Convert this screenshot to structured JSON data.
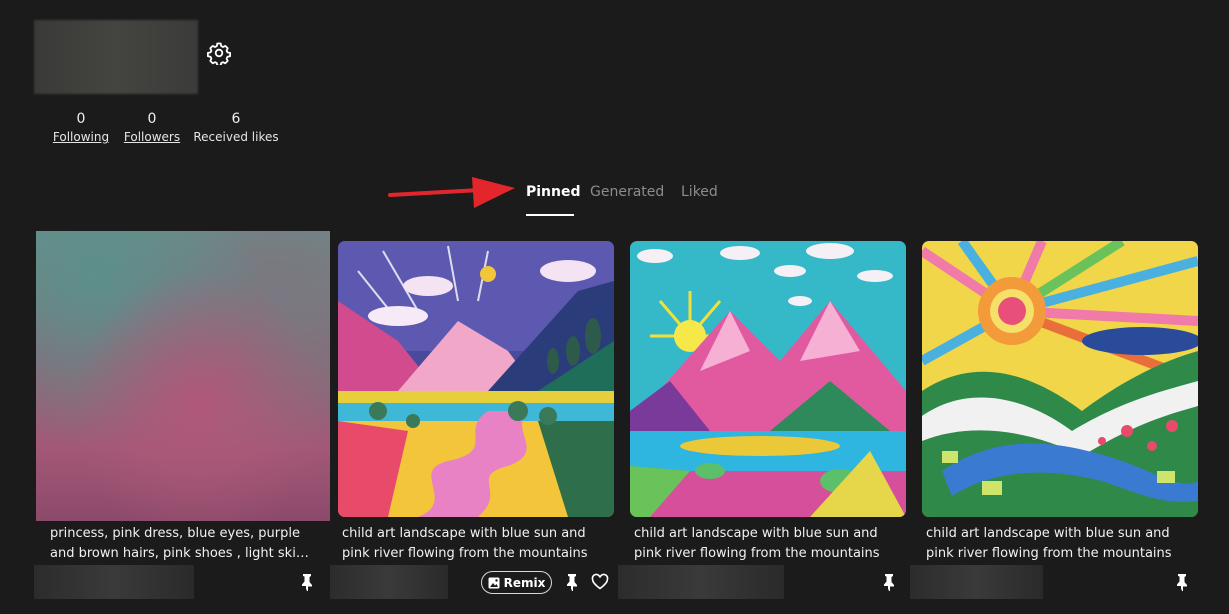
{
  "profile": {
    "stats": [
      {
        "count": "0",
        "label": "Following"
      },
      {
        "count": "0",
        "label": "Followers"
      },
      {
        "count": "6",
        "label": "Received likes"
      }
    ]
  },
  "tabs": [
    {
      "label": "Pinned",
      "active": true
    },
    {
      "label": "Generated",
      "active": false
    },
    {
      "label": "Liked",
      "active": false
    }
  ],
  "cards": [
    {
      "caption_line1": "princess, pink dress, blue eyes, purple",
      "caption_line2": "and brown hairs, pink shoes , light skin..."
    },
    {
      "caption_line1": "child art landscape with blue sun and",
      "caption_line2": "pink river flowing from the mountains"
    },
    {
      "caption_line1": "child art landscape with blue sun and",
      "caption_line2": "pink river flowing from the mountains"
    },
    {
      "caption_line1": "child art landscape with blue sun and",
      "caption_line2": "pink river flowing from the mountains"
    }
  ],
  "actions": {
    "remix_label": "Remix"
  },
  "icons": {
    "settings": "gear-icon",
    "pin": "pin-icon",
    "heart": "heart-icon",
    "remix": "image-edit-icon",
    "annotation": "arrow-icon"
  },
  "colors": {
    "background": "#1b1b1b",
    "active_tab": "#ffffff",
    "inactive_tab": "#8c8c8c",
    "annotation_arrow": "#e3262b"
  }
}
